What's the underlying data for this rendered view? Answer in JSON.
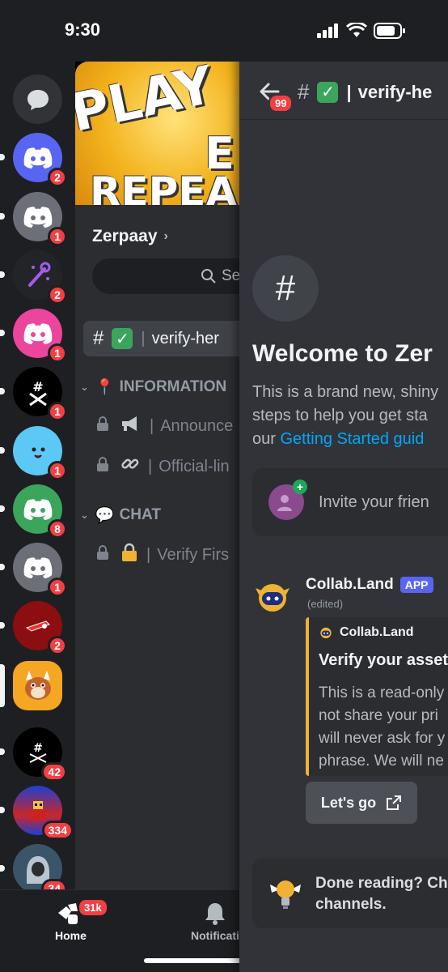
{
  "status_bar": {
    "time": "9:30"
  },
  "rail": {
    "servers": [
      {
        "name": "direct-messages",
        "badge": ""
      },
      {
        "name": "server-1",
        "badge": "2"
      },
      {
        "name": "server-2",
        "badge": "1"
      },
      {
        "name": "server-3",
        "badge": "2"
      },
      {
        "name": "server-4",
        "badge": "1"
      },
      {
        "name": "server-5",
        "badge": "1"
      },
      {
        "name": "server-6",
        "badge": "1"
      },
      {
        "name": "server-7",
        "badge": "8"
      },
      {
        "name": "server-8",
        "badge": "1"
      },
      {
        "name": "server-9",
        "badge": "2"
      },
      {
        "name": "zerpaay",
        "badge": ""
      },
      {
        "name": "server-11",
        "badge": "42"
      },
      {
        "name": "server-12",
        "badge": "334"
      },
      {
        "name": "server-13",
        "badge": "34"
      }
    ]
  },
  "banner": {
    "line1": "PLAY",
    "line2": "E",
    "line3": "REPEA"
  },
  "server": {
    "name": "Zerpaay",
    "search_label": "Se"
  },
  "channels": {
    "selected": {
      "emoji": "✓",
      "name": "verify-her"
    },
    "category_info": {
      "emoji": "📍",
      "label": "INFORMATION"
    },
    "announce": {
      "name": "Announce"
    },
    "official": {
      "name": "Official-lin"
    },
    "category_chat": {
      "emoji": "💬",
      "label": "CHAT"
    },
    "verify_first": {
      "name": "Verify Firs"
    }
  },
  "nav": {
    "home_label": "Home",
    "home_badge": "31k",
    "notif_label": "Notificati"
  },
  "chat": {
    "back_badge": "99",
    "title": "verify-he",
    "title_emoji": "✓",
    "welcome_title": "Welcome to Zer",
    "welcome_line1": "This is a brand new, shiny",
    "welcome_line2": "steps to help you get sta",
    "welcome_line3_prefix": "our ",
    "welcome_link": "Getting Started guid",
    "invite_text": "Invite your frien",
    "message": {
      "author": "Collab.Land",
      "tag": "APP",
      "edited": "(edited)",
      "embed_author": "Collab.Land",
      "embed_title": "Verify your assets",
      "embed_line1": "This is a read-only",
      "embed_line2": "not share your pri",
      "embed_line3": "will never ask for y",
      "embed_line4": "phrase. We will ne",
      "button": "Let's go"
    },
    "done_line1": "Done reading? Che",
    "done_line2": "channels."
  },
  "colors": {
    "accent": "#5865f2",
    "badge": "#f23f43",
    "link": "#00a8fc",
    "embed_bar": "#f0b232"
  }
}
